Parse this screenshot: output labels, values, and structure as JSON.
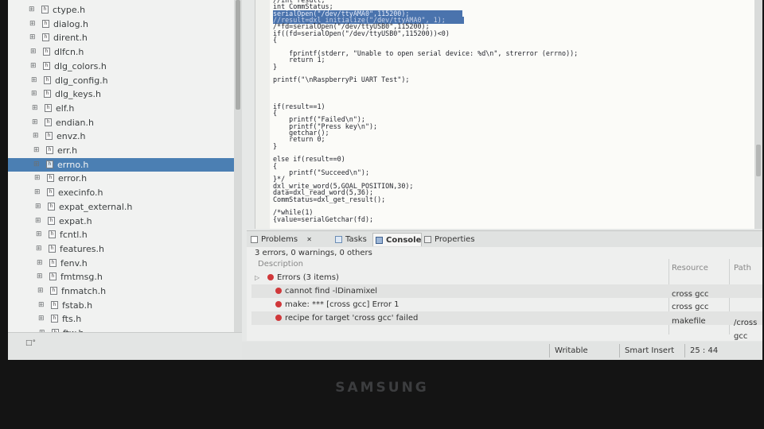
{
  "tree": {
    "items": [
      {
        "name": "ctype.h"
      },
      {
        "name": "dialog.h"
      },
      {
        "name": "dirent.h"
      },
      {
        "name": "dlfcn.h"
      },
      {
        "name": "dlg_colors.h"
      },
      {
        "name": "dlg_config.h"
      },
      {
        "name": "dlg_keys.h"
      },
      {
        "name": "elf.h"
      },
      {
        "name": "endian.h"
      },
      {
        "name": "envz.h"
      },
      {
        "name": "err.h"
      },
      {
        "name": "errno.h",
        "selected": true
      },
      {
        "name": "error.h"
      },
      {
        "name": "execinfo.h"
      },
      {
        "name": "expat_external.h"
      },
      {
        "name": "expat.h"
      },
      {
        "name": "fcntl.h"
      },
      {
        "name": "features.h"
      },
      {
        "name": "fenv.h"
      },
      {
        "name": "fmtmsg.h"
      },
      {
        "name": "fnmatch.h"
      },
      {
        "name": "fstab.h"
      },
      {
        "name": "fts.h"
      },
      {
        "name": "ftw.h"
      }
    ],
    "file_icon_glyph": "h",
    "footer": "□°"
  },
  "editor": {
    "lines": [
      "//int result;",
      "int CommStatus;",
      "serialOpen(\"/dev/ttyAMA0\",115200);",
      "//result=dxl_initialize(\"/dev/ttyAMA0\", 1);",
      "/*fd=serialOpen(\"/dev/ttyUSB0\",115200);",
      "if((fd=serialOpen(\"/dev/ttyUSB0\",115200))<0)",
      "{",
      "",
      "    fprintf(stderr, \"Unable to open serial device: %d\\n\", strerror (errno));",
      "    return 1;",
      "}",
      "",
      "printf(\"\\nRaspberryPi UART Test\");",
      "",
      "",
      "",
      "if(result==1)",
      "{",
      "    printf(\"Failed\\n\");",
      "    printf(\"Press key\\n\");",
      "    getchar();",
      "    return 0;",
      "}",
      "",
      "else if(result==0)",
      "{",
      "    printf(\"Succeed\\n\");",
      "}*/",
      "dxl_write_word(5,GOAL_POSITION,30);",
      "data=dxl_read_word(5,36);",
      "CommStatus=dxl_get_result();",
      "",
      "/*while(1)",
      "{value=serialGetchar(fd);"
    ]
  },
  "bottom": {
    "tabs": [
      {
        "label": "Problems",
        "close": "✕",
        "active": false
      },
      {
        "label": "Tasks",
        "active": false
      },
      {
        "label": "Console",
        "active": true
      },
      {
        "label": "Properties",
        "active": false
      }
    ],
    "summary": "3 errors, 0 warnings, 0 others",
    "columns": {
      "description": "Description",
      "resource": "Resource",
      "path": "Path"
    },
    "group": {
      "label": "Errors (3 items)",
      "toggle": "▷"
    },
    "errors": [
      {
        "description": "cannot find -lDinamixel",
        "resource": "cross gcc",
        "path": ""
      },
      {
        "description": "make: *** [cross gcc] Error 1",
        "resource": "cross gcc",
        "path": ""
      },
      {
        "description": "recipe for target 'cross gcc' failed",
        "resource": "makefile",
        "path": "/cross gcc"
      }
    ],
    "colors": {
      "error": "#d0383a",
      "selection": "#4b7fb3"
    }
  },
  "status": {
    "writable": "Writable",
    "insert_mode": "Smart Insert",
    "position": "25 : 44"
  },
  "bezel": {
    "brand": "SAMSUNG"
  }
}
